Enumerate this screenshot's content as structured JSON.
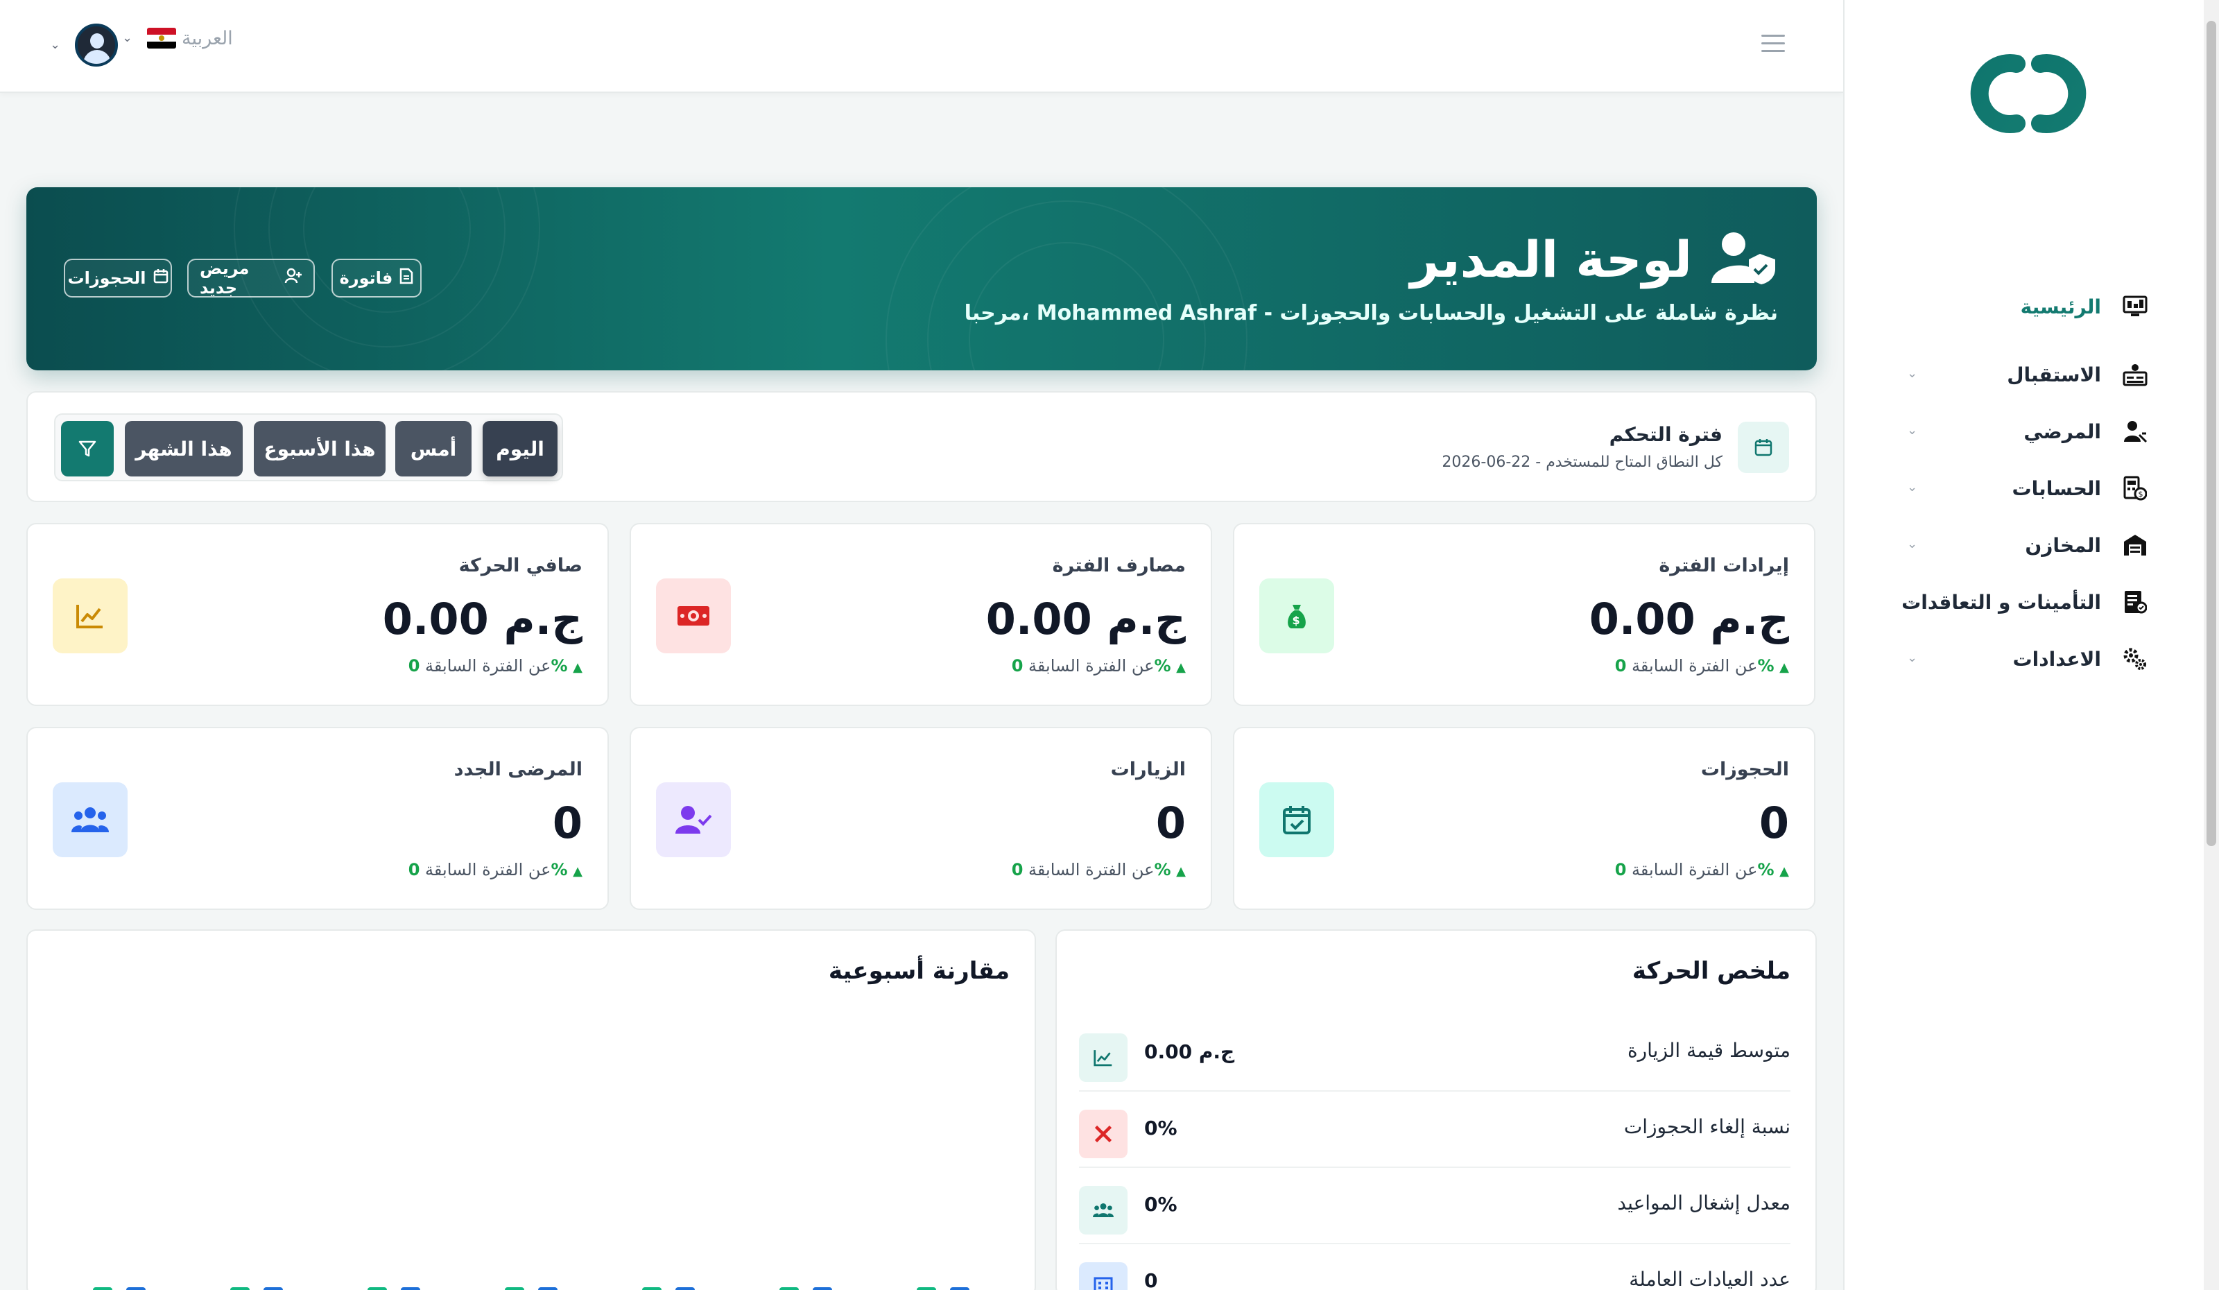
{
  "topbar": {
    "language_label": "العربية"
  },
  "sidebar": {
    "items": [
      {
        "label": "الرئيسية",
        "icon": "monitor-icon",
        "active": true
      },
      {
        "label": "الاستقبال",
        "icon": "reception-icon",
        "active": false
      },
      {
        "label": "المرضي",
        "icon": "patient-icon",
        "active": false
      },
      {
        "label": "الحسابات",
        "icon": "accounts-icon",
        "active": false
      },
      {
        "label": "المخازن",
        "icon": "warehouse-icon",
        "active": false
      },
      {
        "label": "التأمينات و التعاقدات",
        "icon": "insurance-icon",
        "active": false
      },
      {
        "label": "الاعدادات",
        "icon": "settings-icon",
        "active": false
      }
    ]
  },
  "hero": {
    "title": "لوحة المدير",
    "subtitle": "مرحبا، Mohammed Ashraf - نظرة شاملة على التشغيل والحسابات والحجوزات",
    "buttons": {
      "invoice": "فاتورة",
      "new_patient": "مريض جديد",
      "bookings": "الحجوزات"
    }
  },
  "period": {
    "title": "فترة التحكم",
    "range": "2026-06-22 - كل النطاق المتاح للمستخدم",
    "options": {
      "today": "اليوم",
      "yesterday": "أمس",
      "week": "هذا الأسبوع",
      "month": "هذا الشهر"
    },
    "selected": "اليوم"
  },
  "cards": [
    {
      "title": "إيرادات الفترة",
      "value": "0.00",
      "unit": "ج.م",
      "pct": "0%",
      "change_text": "عن الفترة السابقة",
      "icon": "money-bag-icon",
      "color": "#16a34a",
      "bg": "#dcfce7"
    },
    {
      "title": "مصارف الفترة",
      "value": "0.00",
      "unit": "ج.م",
      "pct": "0%",
      "change_text": "عن الفترة السابقة",
      "icon": "banknote-icon",
      "color": "#dc2626",
      "bg": "#fee2e2"
    },
    {
      "title": "صافي الحركة",
      "value": "0.00",
      "unit": "ج.م",
      "pct": "0%",
      "change_text": "عن الفترة السابقة",
      "icon": "chart-line-icon",
      "color": "#ca8a04",
      "bg": "#fef3c7"
    },
    {
      "title": "الحجوزات",
      "value": "0",
      "unit": "",
      "pct": "0%",
      "change_text": "عن الفترة السابقة",
      "icon": "calendar-check-icon",
      "color": "#0f766e",
      "bg": "#ccfbf1"
    },
    {
      "title": "الزيارات",
      "value": "0",
      "unit": "",
      "pct": "0%",
      "change_text": "عن الفترة السابقة",
      "icon": "user-check-icon",
      "color": "#7c3aed",
      "bg": "#ede9fe"
    },
    {
      "title": "المرضى الجدد",
      "value": "0",
      "unit": "",
      "pct": "0%",
      "change_text": "عن الفترة السابقة",
      "icon": "users-icon",
      "color": "#2563eb",
      "bg": "#dbeafe"
    }
  ],
  "summary": {
    "title": "ملخص الحركة",
    "rows": [
      {
        "label": "متوسط قيمة الزيارة",
        "value": "0.00 ج.م",
        "icon": "chart-line-icon",
        "color": "#0f766e",
        "bg": "#e6f6f3"
      },
      {
        "label": "نسبة إلغاء الحجوزات",
        "value": "0%",
        "icon": "close-icon",
        "color": "#dc2626",
        "bg": "#fee2e2"
      },
      {
        "label": "معدل إشغال المواعيد",
        "value": "0%",
        "icon": "users-icon",
        "color": "#0f766e",
        "bg": "#e6f6f3"
      },
      {
        "label": "عدد العيادات العاملة",
        "value": "0",
        "icon": "building-icon",
        "color": "#2563eb",
        "bg": "#dbeafe"
      }
    ]
  },
  "weekly": {
    "title": "مقارنة أسبوعية"
  },
  "chart_data": {
    "type": "bar",
    "categories": [
      "",
      "",
      "",
      "",
      "",
      "",
      ""
    ],
    "series": [
      {
        "values": [
          0,
          0,
          0,
          0,
          0,
          0,
          0
        ],
        "color": "#10b981"
      },
      {
        "values": [
          0,
          0,
          0,
          0,
          0,
          0,
          0
        ],
        "color": "#1d6fd8"
      }
    ]
  }
}
